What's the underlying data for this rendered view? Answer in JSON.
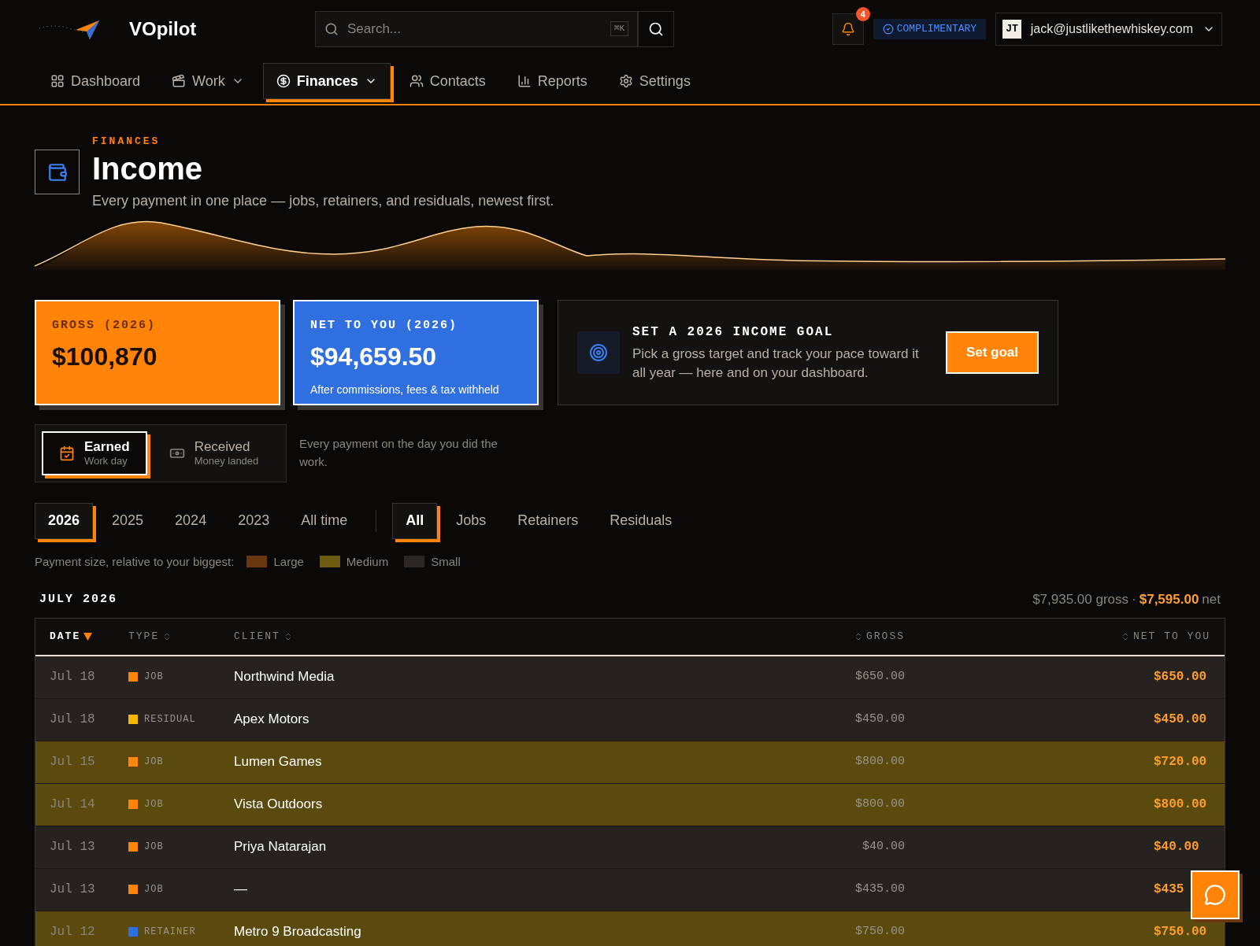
{
  "brand": {
    "name": "VOpilot"
  },
  "search": {
    "placeholder": "Search...",
    "shortcut": "⌘K"
  },
  "notifications": {
    "count": "4"
  },
  "plan_badge": "COMPLIMENTARY",
  "account": {
    "initials": "JT",
    "email": "jack@justlikethewhiskey.com"
  },
  "nav": [
    {
      "label": "Dashboard",
      "dropdown": false,
      "selected": false
    },
    {
      "label": "Work",
      "dropdown": true,
      "selected": false
    },
    {
      "label": "Finances",
      "dropdown": true,
      "selected": true
    },
    {
      "label": "Contacts",
      "dropdown": false,
      "selected": false
    },
    {
      "label": "Reports",
      "dropdown": false,
      "selected": false
    },
    {
      "label": "Settings",
      "dropdown": false,
      "selected": false
    }
  ],
  "header": {
    "eyebrow": "FINANCES",
    "title": "Income",
    "subtitle": "Every payment in one place — jobs, retainers, and residuals, newest first."
  },
  "stats": [
    {
      "label": "GROSS (2026)",
      "value": "$100,870",
      "color": "#ff8408"
    },
    {
      "label": "NET TO YOU (2026)",
      "value": "$94,659.50",
      "note": "After commissions, fees & tax withheld",
      "color": "#2f6fdf"
    }
  ],
  "goal": {
    "title": "SET A 2026 INCOME GOAL",
    "text": "Pick a gross target and track your pace toward it all year — here and on your dashboard.",
    "button": "Set goal"
  },
  "mode_toggle": [
    {
      "label": "Earned",
      "sub": "Work day",
      "selected": true
    },
    {
      "label": "Received",
      "sub": "Money landed",
      "selected": false
    }
  ],
  "mode_hint": "Every payment on the day you did the work.",
  "year_tabs": [
    {
      "label": "2026",
      "selected": true
    },
    {
      "label": "2025",
      "selected": false
    },
    {
      "label": "2024",
      "selected": false
    },
    {
      "label": "2023",
      "selected": false
    },
    {
      "label": "All time",
      "selected": false
    }
  ],
  "type_tabs": [
    {
      "label": "All",
      "selected": true
    },
    {
      "label": "Jobs",
      "selected": false
    },
    {
      "label": "Retainers",
      "selected": false
    },
    {
      "label": "Residuals",
      "selected": false
    }
  ],
  "legend": {
    "label": "Payment size, relative to your biggest:",
    "items": [
      {
        "label": "Large",
        "color": "#6b3710"
      },
      {
        "label": "Medium",
        "color": "#6b5a10"
      },
      {
        "label": "Small",
        "color": "#2b2724"
      }
    ]
  },
  "month": {
    "title": "JULY 2026",
    "gross": "$7,935.00 gross",
    "separator": "·",
    "net": "$7,595.00",
    "net_suffix": "net"
  },
  "table": {
    "columns": [
      {
        "label": "DATE",
        "sorted": true
      },
      {
        "label": "TYPE",
        "sorted": false
      },
      {
        "label": "CLIENT",
        "sorted": false
      },
      {
        "label": "GROSS",
        "sorted": false
      },
      {
        "label": "NET TO YOU",
        "sorted": false
      }
    ],
    "rows": [
      {
        "date": "Jul 18",
        "type": "JOB",
        "color": "#ff8408",
        "client": "Northwind Media",
        "gross": "$650.00",
        "net": "$650.00",
        "kind": "small"
      },
      {
        "date": "Jul 18",
        "type": "RESIDUAL",
        "color": "#f5b800",
        "client": "Apex Motors",
        "gross": "$450.00",
        "net": "$450.00",
        "kind": "small"
      },
      {
        "date": "Jul 15",
        "type": "JOB",
        "color": "#ff8408",
        "client": "Lumen Games",
        "gross": "$800.00",
        "net": "$720.00",
        "kind": "medium"
      },
      {
        "date": "Jul 14",
        "type": "JOB",
        "color": "#ff8408",
        "client": "Vista Outdoors",
        "gross": "$800.00",
        "net": "$800.00",
        "kind": "medium"
      },
      {
        "date": "Jul 13",
        "type": "JOB",
        "color": "#ff8408",
        "client": "Priya Natarajan",
        "gross": "$40.00",
        "net": "$40.00",
        "kind": "small"
      },
      {
        "date": "Jul 13",
        "type": "JOB",
        "color": "#ff8408",
        "client": "—",
        "gross": "$435.00",
        "net": "$435",
        "kind": "small"
      },
      {
        "date": "Jul 12",
        "type": "RETAINER",
        "color": "#2f6fdf",
        "client": "Metro 9 Broadcasting",
        "gross": "$750.00",
        "net": "$750.00",
        "kind": "medium"
      }
    ]
  }
}
